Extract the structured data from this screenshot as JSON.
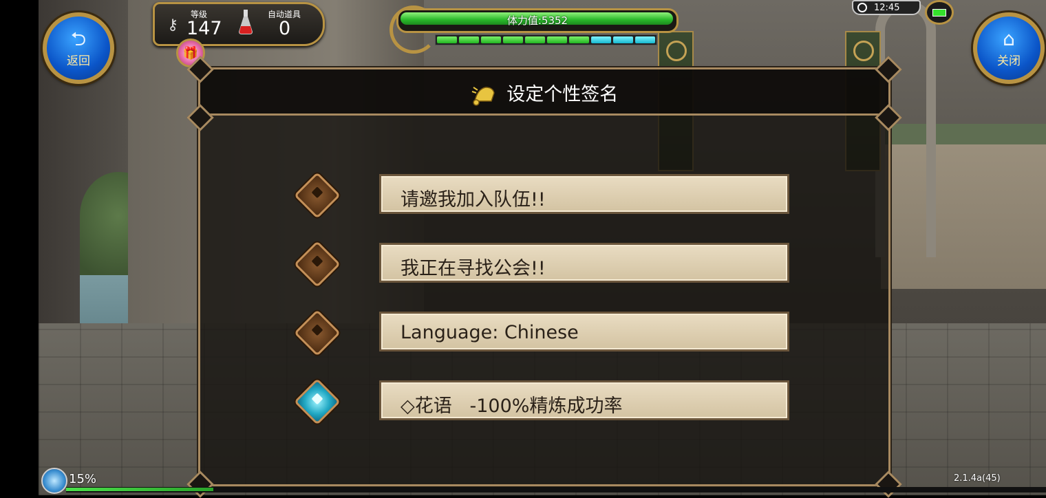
{
  "hud": {
    "back_button": {
      "icon": "return-arrow-icon",
      "label": "返回"
    },
    "close_button": {
      "icon": "home-icon",
      "label": "关闭"
    },
    "level_label": "等级",
    "level_value": "147",
    "auto_items_label": "自动道具",
    "auto_items_value": "0",
    "stamina_text": "体力值:5352",
    "stamina_fill_fraction": 0.98,
    "energy_segments": [
      "green",
      "green",
      "green",
      "green",
      "green",
      "green",
      "green",
      "cyan",
      "cyan",
      "cyan"
    ],
    "clock_time": "12:45",
    "battery_icon": "battery-icon",
    "exp_percent": "15%",
    "exp_fill_fraction": 0.15,
    "version": "2.1.4a(45)"
  },
  "dialog": {
    "title": "设定个性签名",
    "title_icon": "bell-icon",
    "options": [
      {
        "text": "请邀我加入队伍!!",
        "selected": false
      },
      {
        "text": "我正在寻找公会!!",
        "selected": false
      },
      {
        "text": "Language: Chinese",
        "selected": false
      },
      {
        "text": "◇花语   -100%精炼成功率",
        "selected": true
      }
    ]
  },
  "colors": {
    "gold_frame": "#b89343",
    "plate_bg": "#e9dcc2",
    "hp_green": "#29b82a",
    "active_cyan": "#22a9c4"
  }
}
